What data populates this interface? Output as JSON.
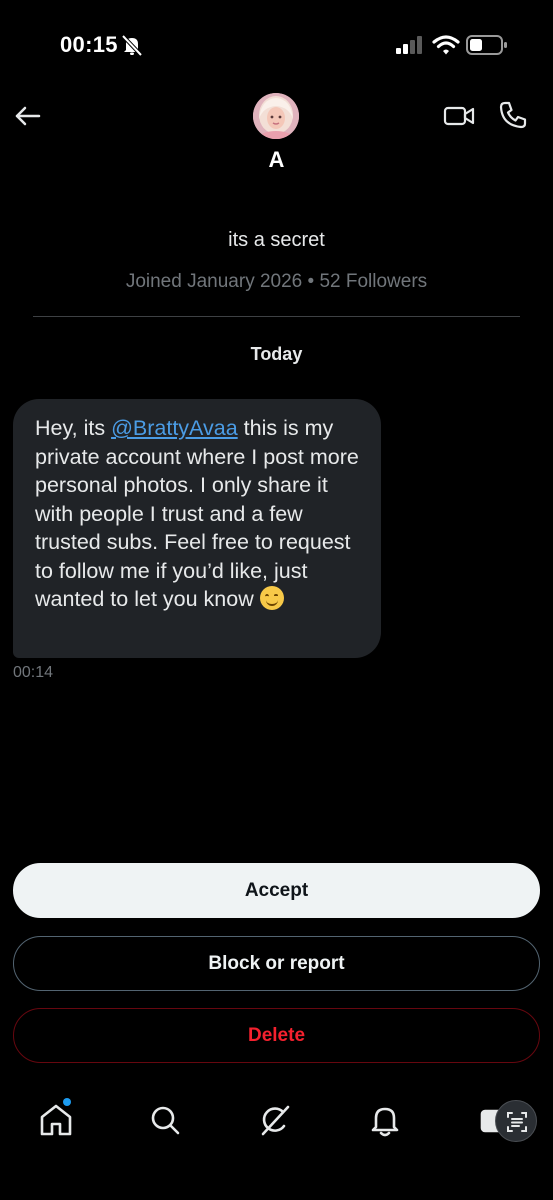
{
  "status_bar": {
    "time": "00:15",
    "icons": [
      "bell-off-icon",
      "signal-icon",
      "wifi-icon",
      "battery-icon"
    ]
  },
  "header": {
    "name": "A",
    "icons": [
      "back-arrow-icon",
      "video-call-icon",
      "phone-icon"
    ]
  },
  "profile": {
    "bio": "its a secret",
    "meta": "Joined January 2026 • 52 Followers"
  },
  "conversation": {
    "day_label": "Today",
    "message": {
      "text_before": "Hey, its ",
      "mention": "@BrattyAvaa",
      "text_after": " this is my private account where I post more personal photos. I only share it with people I trust and a few trusted subs. Feel free to request to follow me if you’d like, just wanted to let you know ",
      "emoji": "smiling-face-emoji",
      "time": "00:14"
    }
  },
  "actions": {
    "accept": "Accept",
    "block": "Block or report",
    "delete": "Delete"
  },
  "bottom_nav": {
    "items": [
      "home-icon",
      "search-icon",
      "grok-icon",
      "notifications-icon",
      "messages-icon"
    ]
  },
  "colors": {
    "background": "#000000",
    "bubble": "#202327",
    "mention": "#4b9ce5",
    "secondary_text": "#71767b",
    "delete": "#f4212e",
    "accept_bg": "#eff3f4"
  }
}
